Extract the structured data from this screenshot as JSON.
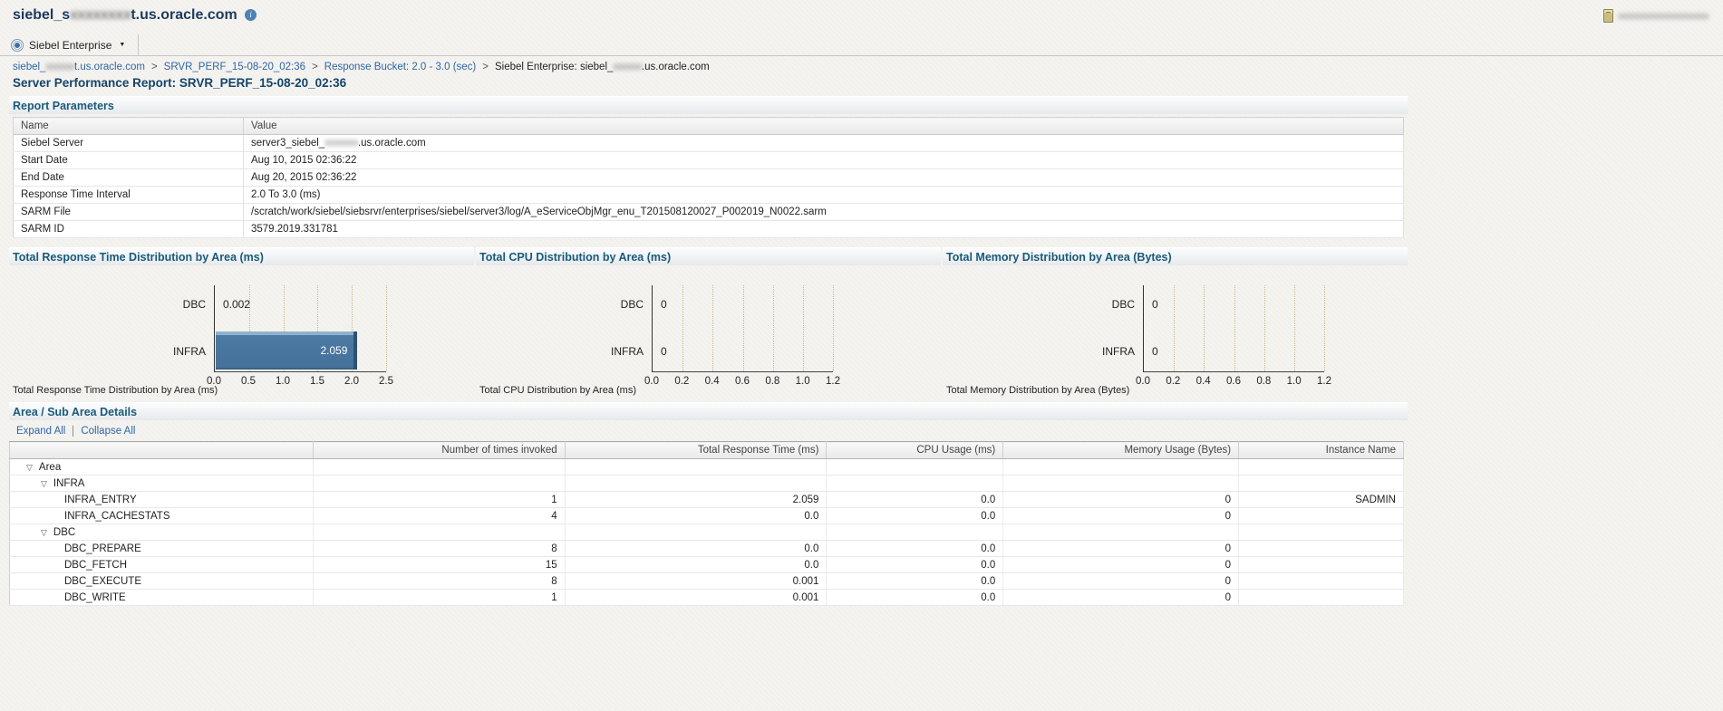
{
  "colors": {
    "link": "#2f66a4",
    "section_title": "#1a5a7a",
    "page_title": "#15456b",
    "app_title": "#1c3a5e",
    "bar_fill": "#4c7aa3",
    "grid_dot": "#c5ba8e"
  },
  "header": {
    "title_prefix": "siebel_s",
    "title_masked": "xxxxxxxx",
    "title_suffix": "t.us.oracle.com",
    "info_icon_glyph": "i",
    "host_badge_masked": "xxxxxxxxxxxxxxxxxxxx",
    "menu_label": "Siebel Enterprise"
  },
  "breadcrumb": {
    "separator": ">",
    "items": [
      {
        "link": true,
        "parts": [
          {
            "text": "siebel_"
          },
          {
            "text": "xxxxxx",
            "masked": true
          },
          {
            "text": "t.us.oracle.com"
          }
        ]
      },
      {
        "link": true,
        "parts": [
          {
            "text": "SRVR_PERF_15-08-20_02:36"
          }
        ]
      },
      {
        "link": true,
        "parts": [
          {
            "text": "Response Bucket: 2.0 - 3.0 (sec)"
          }
        ]
      },
      {
        "link": false,
        "parts": [
          {
            "text": "Siebel Enterprise: siebel_"
          },
          {
            "text": "xxxxxx",
            "masked": true
          },
          {
            "text": ".us.oracle.com"
          }
        ]
      }
    ]
  },
  "page_title": "Server Performance Report: SRVR_PERF_15-08-20_02:36",
  "report_parameters": {
    "title": "Report Parameters",
    "columns": [
      "Name",
      "Value"
    ],
    "rows": [
      {
        "name": "Siebel Server",
        "value_parts": [
          {
            "text": "server3_siebel_"
          },
          {
            "text": "xxxxxxx",
            "masked": true
          },
          {
            "text": ".us.oracle.com"
          }
        ]
      },
      {
        "name": "Start Date",
        "value_parts": [
          {
            "text": "Aug 10, 2015 02:36:22"
          }
        ]
      },
      {
        "name": "End Date",
        "value_parts": [
          {
            "text": "Aug 20, 2015 02:36:22"
          }
        ]
      },
      {
        "name": "Response Time Interval",
        "value_parts": [
          {
            "text": "2.0 To 3.0 (ms)"
          }
        ]
      },
      {
        "name": "SARM File",
        "value_parts": [
          {
            "text": "/scratch/work/siebel/siebsrvr/enterprises/siebel/server3/log/A_eServiceObjMgr_enu_T201508120027_P002019_N0022.sarm"
          }
        ]
      },
      {
        "name": "SARM ID",
        "value_parts": [
          {
            "text": "3579.2019.331781"
          }
        ]
      }
    ]
  },
  "chart_data": [
    {
      "type": "bar",
      "orientation": "horizontal",
      "title": "Total Response Time Distribution by Area (ms)",
      "caption": "Total Response Time Distribution by Area (ms)",
      "categories": [
        "DBC",
        "INFRA"
      ],
      "values": [
        0.002,
        2.059
      ],
      "value_labels": [
        "0.002",
        "2.059"
      ],
      "xlim": [
        0,
        2.5
      ],
      "xticks": [
        "0.0",
        "0.5",
        "1.0",
        "1.5",
        "2.0",
        "2.5"
      ],
      "grid": true,
      "legend": "none"
    },
    {
      "type": "bar",
      "orientation": "horizontal",
      "title": "Total CPU Distribution by Area (ms)",
      "caption": "Total CPU Distribution by Area (ms)",
      "categories": [
        "DBC",
        "INFRA"
      ],
      "values": [
        0,
        0
      ],
      "value_labels": [
        "0",
        "0"
      ],
      "xlim": [
        0,
        1.2
      ],
      "xticks": [
        "0.0",
        "0.2",
        "0.4",
        "0.6",
        "0.8",
        "1.0",
        "1.2"
      ],
      "grid": true,
      "legend": "none"
    },
    {
      "type": "bar",
      "orientation": "horizontal",
      "title": "Total Memory Distribution by Area (Bytes)",
      "caption": "Total Memory Distribution by Area (Bytes)",
      "categories": [
        "DBC",
        "INFRA"
      ],
      "values": [
        0,
        0
      ],
      "value_labels": [
        "0",
        "0"
      ],
      "xlim": [
        0,
        1.2
      ],
      "xticks": [
        "0.0",
        "0.2",
        "0.4",
        "0.6",
        "0.8",
        "1.0",
        "1.2"
      ],
      "grid": true,
      "legend": "none"
    }
  ],
  "area_details": {
    "title": "Area / Sub Area Details",
    "expand_all_label": "Expand All",
    "collapse_all_label": "Collapse All",
    "columns": [
      "",
      "Number of times invoked",
      "Total Response Time (ms)",
      "CPU Usage (ms)",
      "Memory Usage (Bytes)",
      "Instance Name"
    ],
    "rows": [
      {
        "level": 0,
        "group": true,
        "label": "Area",
        "invoked": "",
        "response": "",
        "cpu": "",
        "memory": "",
        "instance": ""
      },
      {
        "level": 1,
        "group": true,
        "label": "INFRA",
        "invoked": "",
        "response": "",
        "cpu": "",
        "memory": "",
        "instance": ""
      },
      {
        "level": 2,
        "group": false,
        "label": "INFRA_ENTRY",
        "invoked": "1",
        "response": "2.059",
        "cpu": "0.0",
        "memory": "0",
        "instance": "SADMIN"
      },
      {
        "level": 2,
        "group": false,
        "label": "INFRA_CACHESTATS",
        "invoked": "4",
        "response": "0.0",
        "cpu": "0.0",
        "memory": "0",
        "instance": ""
      },
      {
        "level": 1,
        "group": true,
        "label": "DBC",
        "invoked": "",
        "response": "",
        "cpu": "",
        "memory": "",
        "instance": ""
      },
      {
        "level": 2,
        "group": false,
        "label": "DBC_PREPARE",
        "invoked": "8",
        "response": "0.0",
        "cpu": "0.0",
        "memory": "0",
        "instance": ""
      },
      {
        "level": 2,
        "group": false,
        "label": "DBC_FETCH",
        "invoked": "15",
        "response": "0.0",
        "cpu": "0.0",
        "memory": "0",
        "instance": ""
      },
      {
        "level": 2,
        "group": false,
        "label": "DBC_EXECUTE",
        "invoked": "8",
        "response": "0.001",
        "cpu": "0.0",
        "memory": "0",
        "instance": ""
      },
      {
        "level": 2,
        "group": false,
        "label": "DBC_WRITE",
        "invoked": "1",
        "response": "0.001",
        "cpu": "0.0",
        "memory": "0",
        "instance": ""
      }
    ]
  }
}
